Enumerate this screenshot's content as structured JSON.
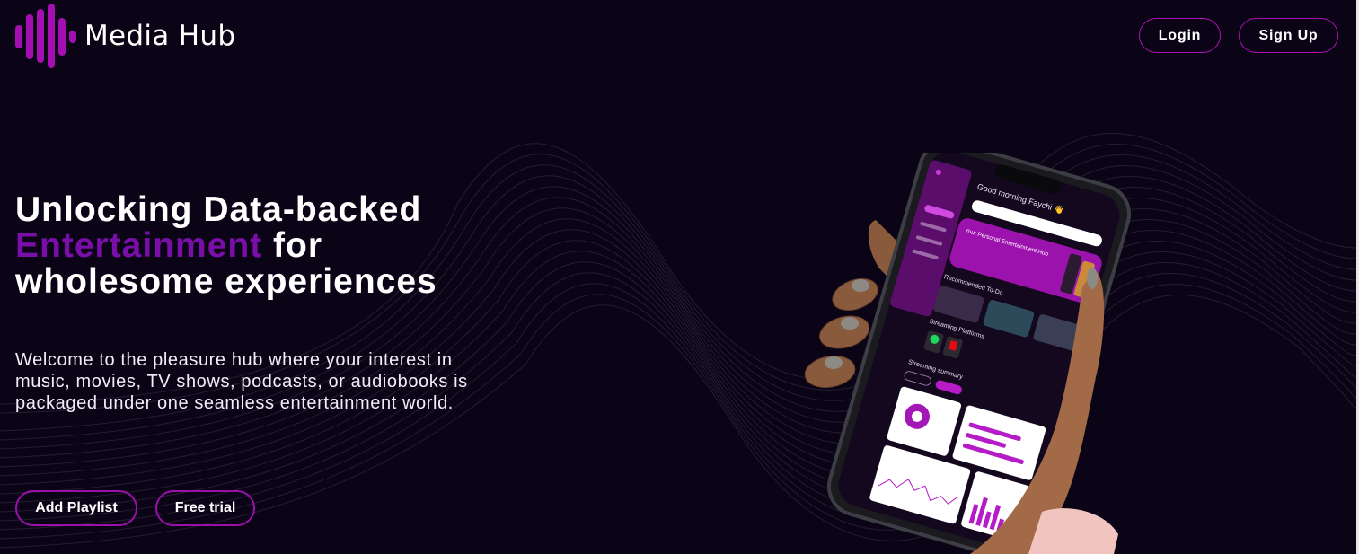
{
  "brand": {
    "name": "Media Hub"
  },
  "header": {
    "login_label": "Login",
    "signup_label": "Sign Up"
  },
  "hero": {
    "title_line1": "Unlocking Data-backed",
    "title_accent": "Entertainment",
    "title_after_accent": " for",
    "title_line3": "wholesome experiences",
    "description": "Welcome to the pleasure hub where your interest in music, movies, TV shows, podcasts, or audiobooks is packaged under one seamless entertainment world.",
    "add_playlist_label": "Add Playlist",
    "free_trial_label": "Free trial"
  },
  "phone_screen": {
    "greeting": "Good morning Faychi 👋",
    "promo_title": "Your Personal Entertainment Hub",
    "recommended_heading": "Recommended To-Do",
    "platforms_heading": "Streaming Platforms",
    "summary_heading": "Streaming summary"
  },
  "colors": {
    "background": "#0b0416",
    "accent": "#7a0ea8",
    "button_border": "#b010b8",
    "logo": "#a40fb2"
  }
}
